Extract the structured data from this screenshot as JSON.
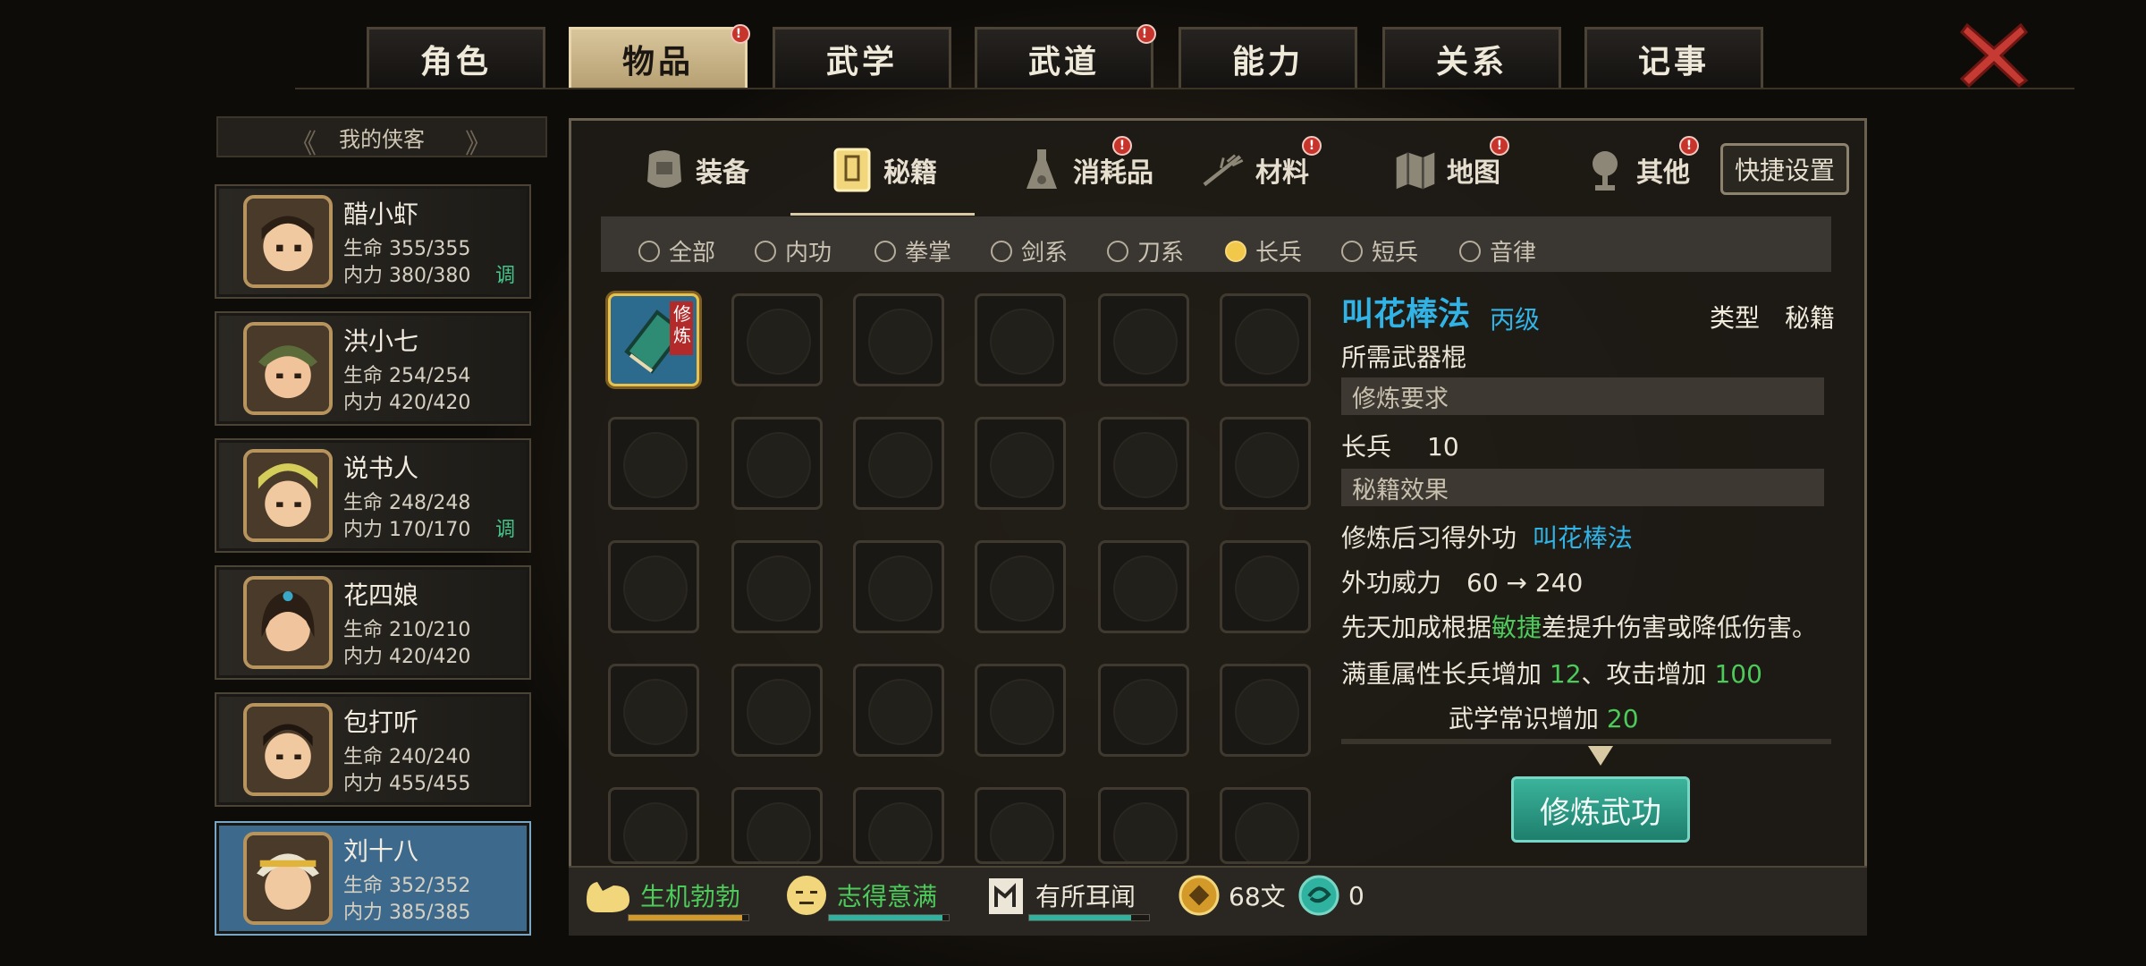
{
  "tabs": [
    {
      "label": "角色",
      "active": false,
      "badge": false
    },
    {
      "label": "物品",
      "active": true,
      "badge": true
    },
    {
      "label": "武学",
      "active": false,
      "badge": false
    },
    {
      "label": "武道",
      "active": false,
      "badge": true
    },
    {
      "label": "能力",
      "active": false,
      "badge": false
    },
    {
      "label": "关系",
      "active": false,
      "badge": false
    },
    {
      "label": "记事",
      "active": false,
      "badge": false
    }
  ],
  "badge_mark": "!",
  "party": {
    "header": "我的侠客",
    "members": [
      {
        "name": "醋小虾",
        "hp": "生命 355/355",
        "mp": "内力 380/380",
        "tag": "调"
      },
      {
        "name": "洪小七",
        "hp": "生命 254/254",
        "mp": "内力 420/420",
        "tag": ""
      },
      {
        "name": "说书人",
        "hp": "生命 248/248",
        "mp": "内力 170/170",
        "tag": "调"
      },
      {
        "name": "花四娘",
        "hp": "生命 210/210",
        "mp": "内力 420/420",
        "tag": ""
      },
      {
        "name": "包打听",
        "hp": "生命 240/240",
        "mp": "内力 455/455",
        "tag": ""
      },
      {
        "name": "刘十八",
        "hp": "生命 352/352",
        "mp": "内力 385/385",
        "tag": ""
      }
    ]
  },
  "subtabs": [
    {
      "label": "装备",
      "icon": "armor-icon"
    },
    {
      "label": "秘籍",
      "icon": "book-icon",
      "active": true
    },
    {
      "label": "消耗品",
      "icon": "potion-icon",
      "badge": true
    },
    {
      "label": "材料",
      "icon": "herb-icon",
      "badge": true
    },
    {
      "label": "地图",
      "icon": "map-icon",
      "badge": true
    },
    {
      "label": "其他",
      "icon": "misc-icon",
      "badge": true
    }
  ],
  "quick_settings": "快捷设置",
  "filters": [
    {
      "label": "全部",
      "on": false
    },
    {
      "label": "内功",
      "on": false
    },
    {
      "label": "拳掌",
      "on": false
    },
    {
      "label": "剑系",
      "on": false
    },
    {
      "label": "刀系",
      "on": false
    },
    {
      "label": "长兵",
      "on": true
    },
    {
      "label": "短兵",
      "on": false
    },
    {
      "label": "音律",
      "on": false
    }
  ],
  "item_tag": "修炼",
  "detail": {
    "title": "叫花棒法",
    "grade": "丙级",
    "type": "类型　秘籍",
    "weapon": "所需武器棍",
    "req_header": "修炼要求",
    "req_name": "长兵",
    "req_value": "10",
    "effect_header": "秘籍效果",
    "learn_prefix": "修炼后习得外功",
    "learn_name": "叫花棒法",
    "power": "外功威力　60 → 240",
    "innate_prefix": "先天加成根据",
    "innate_attr": "敏捷",
    "innate_suffix": "差提升伤害或降低伤害。",
    "full_prefix": "满重属性长兵增加 ",
    "full_v1": "12",
    "full_mid": "、攻击增加 ",
    "full_v2": "100",
    "full2_prefix": "武学常识增加 ",
    "full2_v": "20",
    "button": "修炼武功"
  },
  "status": {
    "s1": {
      "label": "生机勃勃",
      "color": "#4ccb5a",
      "fill": 0.95,
      "bar": "#d39a2a"
    },
    "s2": {
      "label": "志得意满",
      "color": "#4ccb5a",
      "fill": 0.95,
      "bar": "#2fb3a0"
    },
    "s3": {
      "label": "有所耳闻",
      "color": "#ece6d8",
      "fill": 0.85,
      "bar": "#2fb3a0"
    },
    "money": "68文",
    "jade": "0"
  }
}
